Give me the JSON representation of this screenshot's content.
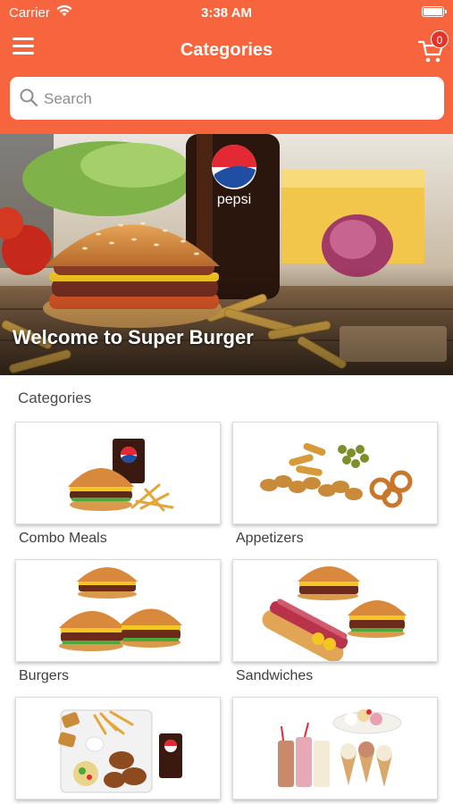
{
  "status_bar": {
    "carrier": "Carrier",
    "time": "3:38 AM"
  },
  "nav": {
    "title": "Categories",
    "cart_count": "0"
  },
  "search": {
    "placeholder": "Search"
  },
  "banner": {
    "title": "Welcome to Super Burger",
    "bottle_brand": "pepsi"
  },
  "categories_heading": "Categories",
  "categories": [
    {
      "label": "Combo Meals"
    },
    {
      "label": "Appetizers"
    },
    {
      "label": "Burgers"
    },
    {
      "label": "Sandwiches"
    },
    {
      "label": ""
    },
    {
      "label": ""
    }
  ],
  "colors": {
    "header": "#f7653f",
    "badge": "#e53225",
    "text": "#3e3e3e"
  }
}
